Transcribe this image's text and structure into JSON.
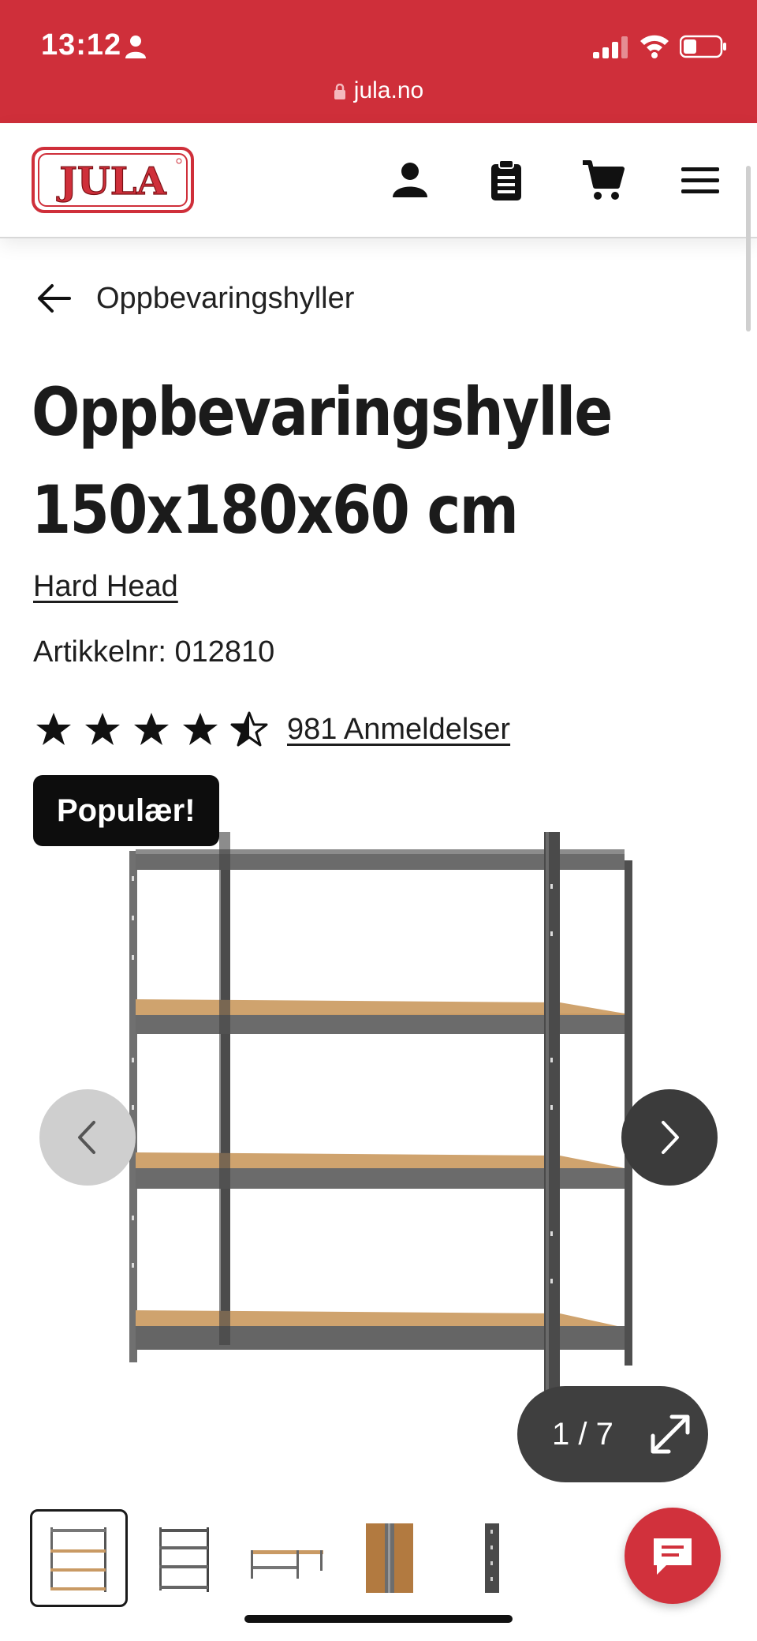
{
  "status": {
    "time": "13:12",
    "url": "jula.no"
  },
  "header": {
    "logo_text": "JULA"
  },
  "breadcrumb": {
    "label": "Oppbevaringshyller"
  },
  "product": {
    "title_line1": "Oppbevaringshylle",
    "title_line2": "150x180x60 cm",
    "brand": "Hard Head",
    "article": "Artikkelnr: 012810",
    "rating": 4.5,
    "reviews": "981 Anmeldelser",
    "badge": "Populær!"
  },
  "gallery": {
    "counter": "1 / 7",
    "current": 1,
    "total": 7
  },
  "colors": {
    "brand_red": "#cf2f3a",
    "dark": "#1a1a1a"
  }
}
